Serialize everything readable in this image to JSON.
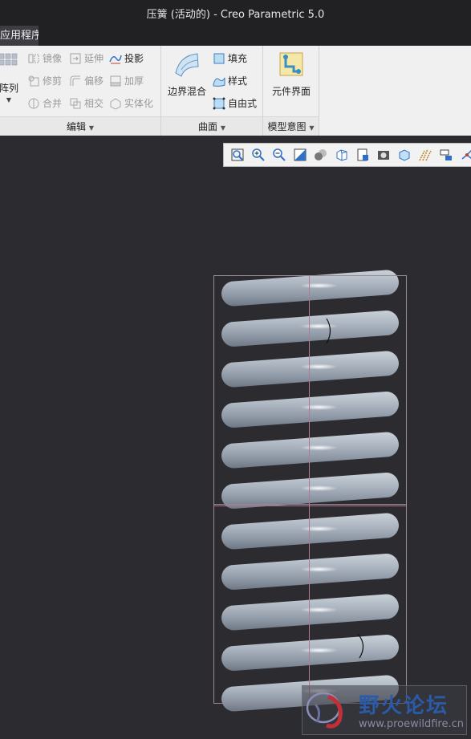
{
  "window": {
    "title": "压簧 (活动的) - Creo Parametric 5.0"
  },
  "tabs": {
    "active": "应用程序"
  },
  "ribbon": {
    "edit": {
      "label": "编辑",
      "array": "阵列",
      "mirror": "镜像",
      "extend": "延伸",
      "project": "投影",
      "trim": "修剪",
      "offset": "偏移",
      "thicken": "加厚",
      "merge": "合并",
      "intersect": "相交",
      "solidify": "实体化"
    },
    "surface": {
      "label": "曲面",
      "boundary_blend": "边界混合",
      "fill": "填充",
      "style": "样式",
      "freestyle": "自由式"
    },
    "model_intent": {
      "label": "模型意图",
      "component_interface": "元件界面"
    }
  },
  "view_toolbar": {
    "icons": [
      "refit-icon",
      "zoom-in-icon",
      "zoom-out-icon",
      "repaint-icon",
      "shading-icon",
      "saved-orientations-icon",
      "view-manager-icon",
      "perspective-icon",
      "display-style-icon",
      "datum-display-icon",
      "annotation-display-icon",
      "spin-center-icon"
    ]
  },
  "watermark": {
    "title": "野火论坛",
    "url": "www.proewildfire.cn"
  },
  "colors": {
    "spring": "#a9b2bd",
    "background": "#2b2b30",
    "ribbon": "#f0f0f0",
    "box": "#a88a9a"
  }
}
